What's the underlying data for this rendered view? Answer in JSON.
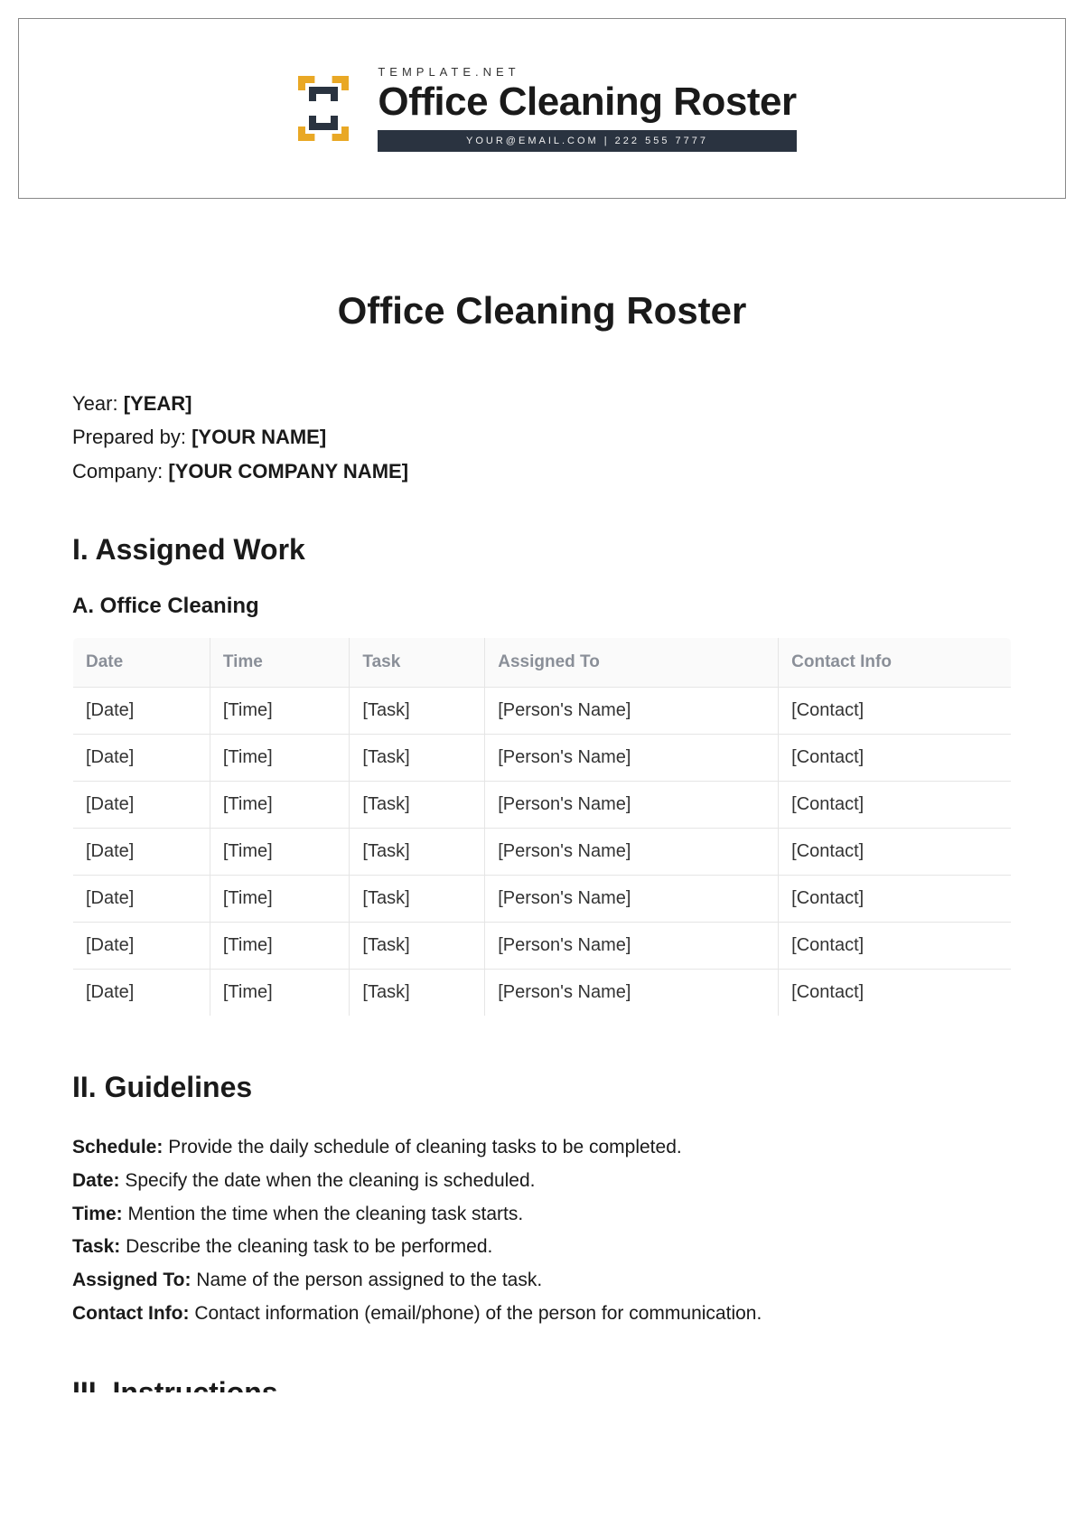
{
  "banner": {
    "overline": "TEMPLATE.NET",
    "title": "Office Cleaning Roster",
    "contact_bar": "YOUR@EMAIL.COM | 222 555 7777"
  },
  "doc": {
    "title": "Office Cleaning Roster",
    "meta": {
      "year_label": "Year: ",
      "year_value": "[YEAR]",
      "prepared_label": "Prepared by: ",
      "prepared_value": "[YOUR NAME]",
      "company_label": "Company: ",
      "company_value": "[YOUR COMPANY NAME]"
    },
    "section1_heading": "I. Assigned Work",
    "section1a_heading": "A. Office Cleaning",
    "table": {
      "headers": {
        "date": "Date",
        "time": "Time",
        "task": "Task",
        "assigned": "Assigned To",
        "contact": "Contact Info"
      },
      "rows": [
        {
          "date": "[Date]",
          "time": "[Time]",
          "task": "[Task]",
          "assigned": "[Person's Name]",
          "contact": "[Contact]"
        },
        {
          "date": "[Date]",
          "time": "[Time]",
          "task": "[Task]",
          "assigned": "[Person's Name]",
          "contact": "[Contact]"
        },
        {
          "date": "[Date]",
          "time": "[Time]",
          "task": "[Task]",
          "assigned": "[Person's Name]",
          "contact": "[Contact]"
        },
        {
          "date": "[Date]",
          "time": "[Time]",
          "task": "[Task]",
          "assigned": "[Person's Name]",
          "contact": "[Contact]"
        },
        {
          "date": "[Date]",
          "time": "[Time]",
          "task": "[Task]",
          "assigned": "[Person's Name]",
          "contact": "[Contact]"
        },
        {
          "date": "[Date]",
          "time": "[Time]",
          "task": "[Task]",
          "assigned": "[Person's Name]",
          "contact": "[Contact]"
        },
        {
          "date": "[Date]",
          "time": "[Time]",
          "task": "[Task]",
          "assigned": "[Person's Name]",
          "contact": "[Contact]"
        }
      ]
    },
    "section2_heading": "II. Guidelines",
    "guidelines": [
      {
        "label": "Schedule:",
        "text": " Provide the daily schedule of cleaning tasks to be completed."
      },
      {
        "label": "Date:",
        "text": " Specify the date when the cleaning is scheduled."
      },
      {
        "label": "Time:",
        "text": " Mention the time when the cleaning task starts."
      },
      {
        "label": "Task:",
        "text": " Describe the cleaning task to be performed."
      },
      {
        "label": "Assigned To:",
        "text": " Name of the person assigned to the task."
      },
      {
        "label": "Contact Info:",
        "text": " Contact information (email/phone) of the person for communication."
      }
    ],
    "section3_heading_partial": "III. Instructions"
  }
}
